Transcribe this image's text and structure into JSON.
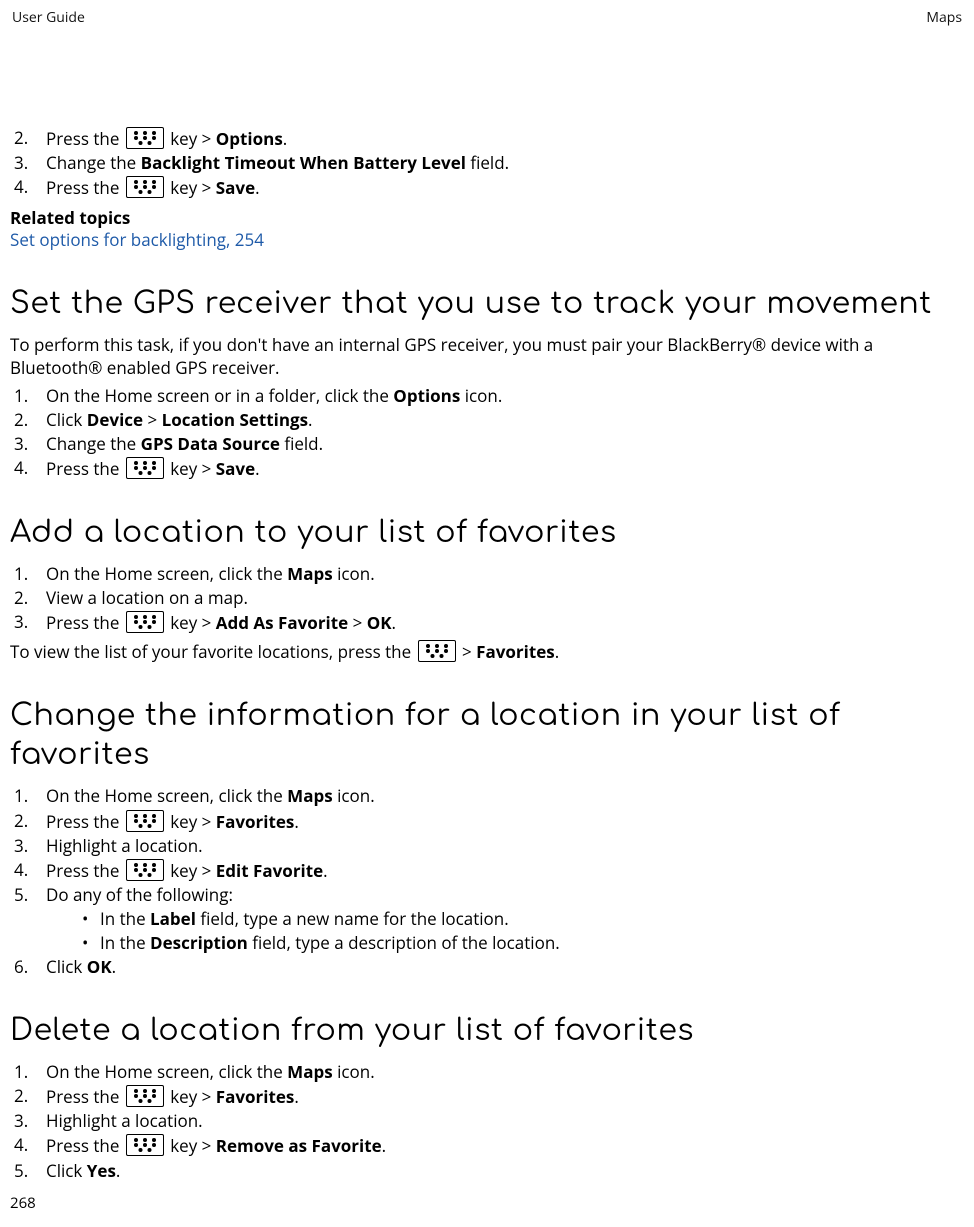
{
  "header": {
    "left": "User Guide",
    "right": "Maps"
  },
  "footer": {
    "pagenum": "268"
  },
  "section0": {
    "steps": [
      {
        "n": "2.",
        "pre": "Press the ",
        "post": " key > ",
        "target": "Options",
        "after": "."
      },
      {
        "n": "3.",
        "plain_pre": "Change the ",
        "plain_bold": "Backlight Timeout When Battery Level",
        "plain_post": " field."
      },
      {
        "n": "4.",
        "pre": "Press the ",
        "post": " key > ",
        "target": "Save",
        "after": "."
      }
    ],
    "related_hd": "Related topics",
    "related_link": "Set options for backlighting, 254"
  },
  "section_gps": {
    "title": "Set the GPS receiver that you use to track your movement",
    "intro": "To perform this task, if you don't have an internal GPS receiver, you must pair your BlackBerry® device with a Bluetooth® enabled GPS receiver.",
    "steps": [
      {
        "n": "1.",
        "plain_pre": "On the Home screen or in a folder, click the ",
        "plain_bold": "Options",
        "plain_post": " icon."
      },
      {
        "n": "2.",
        "click_pre": "Click ",
        "click_a": "Device",
        "click_sep": " > ",
        "click_b": "Location Settings",
        "click_post": "."
      },
      {
        "n": "3.",
        "plain_pre": "Change the ",
        "plain_bold": "GPS Data Source",
        "plain_post": " field."
      },
      {
        "n": "4.",
        "pre": "Press the ",
        "post": " key > ",
        "target": "Save",
        "after": "."
      }
    ]
  },
  "section_addfav": {
    "title": "Add a location to your list of favorites",
    "steps": [
      {
        "n": "1.",
        "plain_pre": "On the Home screen, click the ",
        "plain_bold": "Maps",
        "plain_post": " icon."
      },
      {
        "n": "2.",
        "text": "View a location on a map."
      },
      {
        "n": "3.",
        "pre": "Press the ",
        "post": " key > ",
        "target": "Add As Favorite",
        "sep2": " > ",
        "target2": "OK",
        "after": "."
      }
    ],
    "outro_pre": "To view the list of your favorite locations, press the ",
    "outro_sep": " > ",
    "outro_bold": "Favorites",
    "outro_after": "."
  },
  "section_changefav": {
    "title": "Change the information for a location in your list of favorites",
    "steps": [
      {
        "n": "1.",
        "plain_pre": "On the Home screen, click the ",
        "plain_bold": "Maps",
        "plain_post": " icon."
      },
      {
        "n": "2.",
        "pre": "Press the ",
        "post": " key > ",
        "target": "Favorites",
        "after": "."
      },
      {
        "n": "3.",
        "text": "Highlight a location."
      },
      {
        "n": "4.",
        "pre": "Press the ",
        "post": " key > ",
        "target": "Edit Favorite",
        "after": "."
      },
      {
        "n": "5.",
        "text": "Do any of the following:"
      },
      {
        "n": "6.",
        "click_pre": "Click ",
        "click_a": "OK",
        "click_post": "."
      }
    ],
    "sub": [
      {
        "pre": "In the ",
        "bold": "Label",
        "post": " field, type a new name for the location."
      },
      {
        "pre": "In the ",
        "bold": "Description",
        "post": " field, type a description of the location."
      }
    ]
  },
  "section_delfav": {
    "title": "Delete a location from your list of favorites",
    "steps": [
      {
        "n": "1.",
        "plain_pre": "On the Home screen, click the ",
        "plain_bold": "Maps",
        "plain_post": " icon."
      },
      {
        "n": "2.",
        "pre": "Press the ",
        "post": " key > ",
        "target": "Favorites",
        "after": "."
      },
      {
        "n": "3.",
        "text": "Highlight a location."
      },
      {
        "n": "4.",
        "pre": "Press the ",
        "post": " key > ",
        "target": "Remove as Favorite",
        "after": "."
      },
      {
        "n": "5.",
        "click_pre": "Click ",
        "click_a": "Yes",
        "click_post": "."
      }
    ]
  }
}
